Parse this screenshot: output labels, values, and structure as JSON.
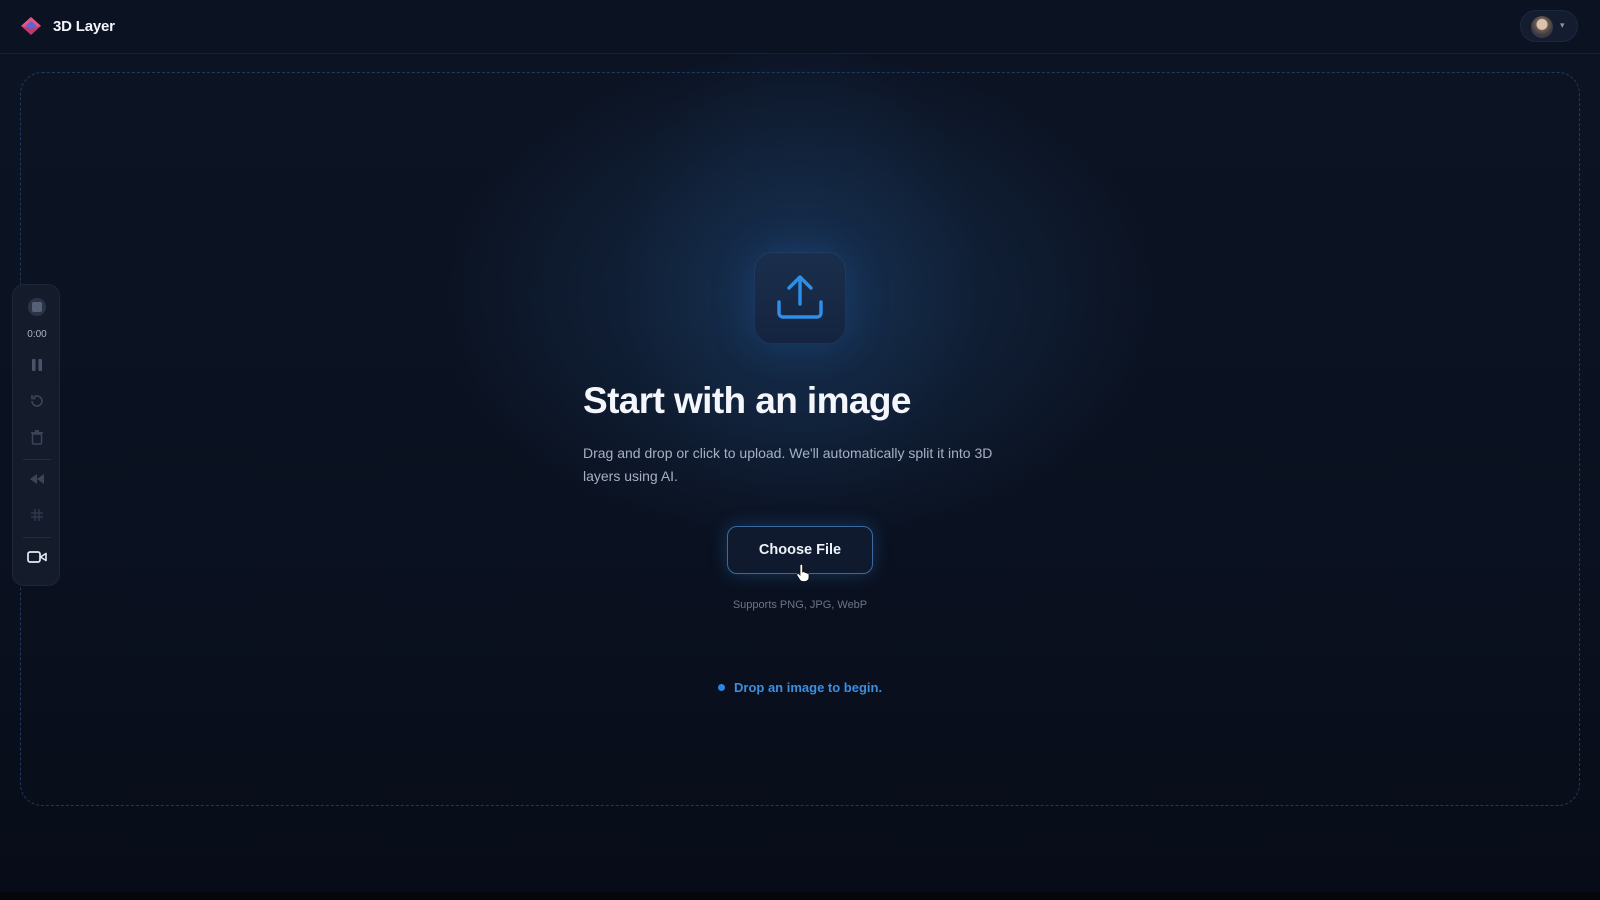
{
  "app": {
    "title": "3D Layer"
  },
  "header": {
    "logo_icon": "layered-diamond-logo",
    "user_avatar_icon": "user-avatar",
    "user_menu_icon": "chevron-down-icon"
  },
  "toolbar": {
    "timer": "0:00",
    "icons": [
      "record-icon",
      "pause-icon",
      "reset-icon",
      "trash-icon",
      "rewind-icon",
      "grid-icon",
      "camera-icon"
    ]
  },
  "upload": {
    "icon": "upload-icon",
    "headline": "Start with an image",
    "description": "Drag and drop or click to upload. We'll automatically split it into 3D layers using AI.",
    "button_label": "Choose File",
    "supported_formats": "Supports PNG, JPG, WebP",
    "status": "Drop an image to begin."
  },
  "colors": {
    "accent": "#3b8fe0",
    "background": "#0a0f1c",
    "button_border": "#3a6aa0"
  }
}
